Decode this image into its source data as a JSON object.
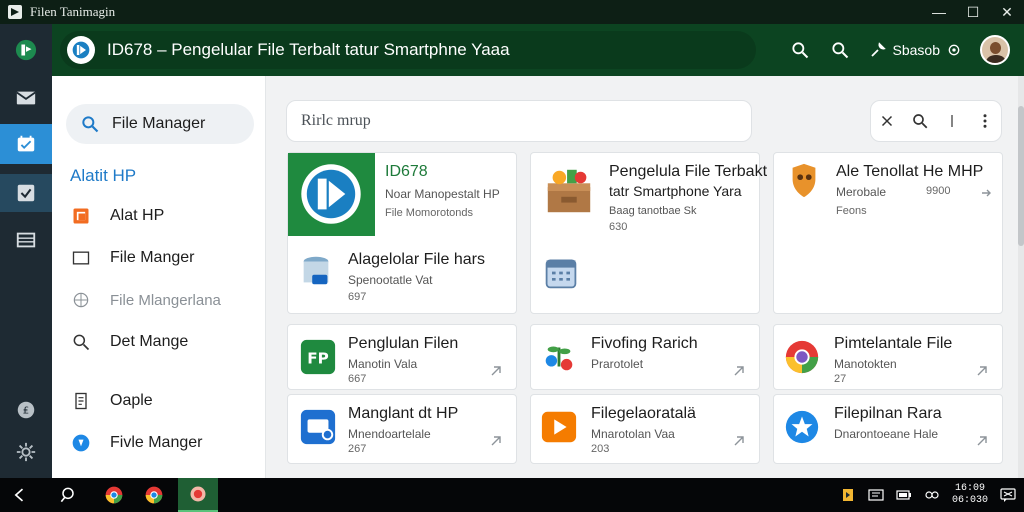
{
  "window": {
    "title": "Filen Tanimagin",
    "controls": {
      "minimize": "—",
      "maximize": "☐",
      "close": "✕"
    }
  },
  "header": {
    "title": "ID678 – Pengelular File Terbalt tatur Smartphne Yaaa",
    "settings_label": "Sbasob",
    "icons": [
      "search-icon",
      "search-icon",
      "wrench-icon",
      "gear-icon",
      "avatar"
    ]
  },
  "rail": {
    "items": [
      "app-logo",
      "mail-icon",
      "file-manager-icon",
      "checkbox-icon",
      "list-icon"
    ],
    "bottom": [
      "coin-icon",
      "gear-icon"
    ],
    "active_index": 2
  },
  "sidebar": {
    "search_label": "File Manager",
    "section_title": "Alatit HP",
    "items": [
      {
        "label": "Alat HP",
        "icon": "orange-folder-icon"
      },
      {
        "label": "File Manger",
        "icon": "window-icon"
      },
      {
        "label": "File Mlangerlana",
        "icon": "globe-icon"
      },
      {
        "label": "Det Mange",
        "icon": "search-icon"
      },
      {
        "label": "Oaple",
        "icon": "document-icon"
      },
      {
        "label": "Fivle Manger",
        "icon": "blue-circle-icon"
      }
    ]
  },
  "main": {
    "search_placeholder": "Rirlc mrup",
    "tools": [
      "close-icon",
      "search-icon",
      "divider",
      "more-icon"
    ],
    "cards_row1": [
      {
        "title": "ID678",
        "sub": "Noar Manopestalt HP",
        "meta": "File Momorotonds",
        "title2": "Alagelolar File hars",
        "sub2": "Spenootatle Vat",
        "meta2": "697"
      },
      {
        "title": "Pengelula File Terbakt",
        "title_line2": "tatr Smartphone Yara",
        "sub": "Baag tanotbae Sk",
        "meta": "630"
      },
      {
        "title": "Ale Tenollat He MHP",
        "sub": "Merobale",
        "meta": "Feons",
        "side": "9900"
      }
    ],
    "cards_row2": [
      {
        "title": "Penglulan Filen",
        "sub": "Manotin Vala",
        "meta": "667",
        "icon": "fp-icon"
      },
      {
        "title": "Fivofing Rarich",
        "sub": "Prarotolet",
        "meta": "",
        "icon": "plant-icon"
      },
      {
        "title": "Pimtelantale File",
        "sub": "Manotokten",
        "meta": "27",
        "icon": "chrome-icon"
      }
    ],
    "cards_row3": [
      {
        "title": "Manglant dt HP",
        "sub": "Mnendoartelale",
        "meta": "267",
        "icon": "blue-app-icon"
      },
      {
        "title": "Filegelaoratalä",
        "sub": "Mnarotolan Vaa",
        "meta": "203",
        "icon": "play-icon"
      },
      {
        "title": "Filepilnan Rara",
        "sub": "Dnarontoeane Hale",
        "meta": "",
        "icon": "blue-star-icon"
      }
    ]
  },
  "taskbar": {
    "items": [
      "back-icon",
      "search-icon",
      "chrome-icon",
      "chrome-icon",
      "app-icon"
    ],
    "active_index": 4,
    "clock_line1": "16:09",
    "clock_line2": "06:030"
  },
  "colors": {
    "header_bg": "#0c4421",
    "rail_bg": "#1e2a33",
    "rail_active": "#2c8fd6",
    "section_title": "#1e7ac8",
    "main_bg": "#f1f2f3"
  }
}
